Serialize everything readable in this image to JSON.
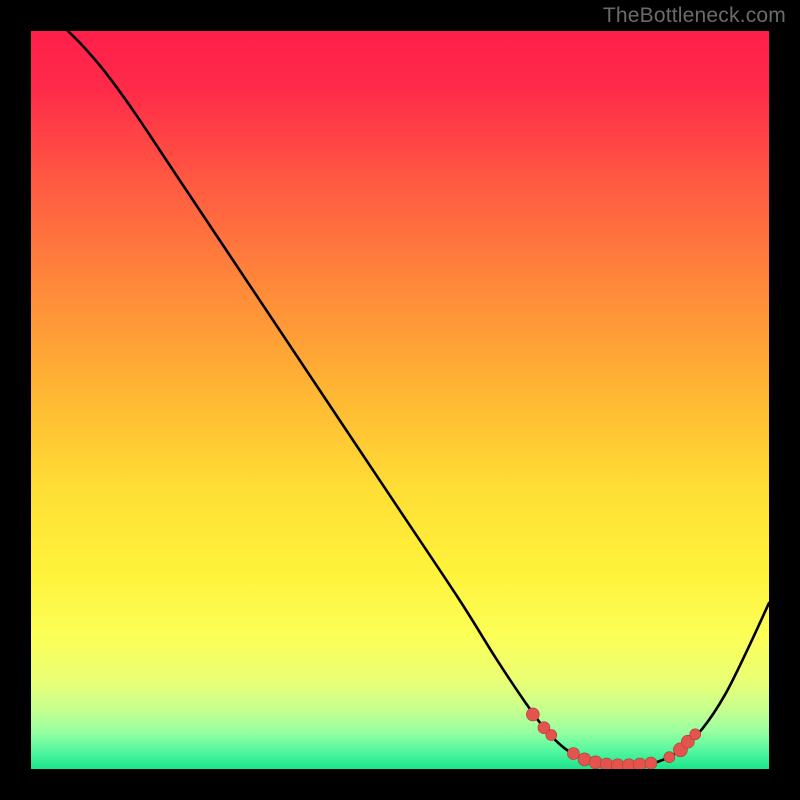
{
  "watermark": "TheBottleneck.com",
  "colors": {
    "curve": "#000000",
    "marker_fill": "#e4544f",
    "marker_stroke": "#b23935"
  },
  "chart_data": {
    "type": "line",
    "title": "",
    "xlabel": "",
    "ylabel": "",
    "xlim": [
      0,
      100
    ],
    "ylim": [
      0,
      100
    ],
    "curve": [
      {
        "x": 5.0,
        "y": 100.0
      },
      {
        "x": 7.0,
        "y": 98.0
      },
      {
        "x": 10.0,
        "y": 94.5
      },
      {
        "x": 14.0,
        "y": 89.0
      },
      {
        "x": 20.0,
        "y": 80.0
      },
      {
        "x": 30.0,
        "y": 65.0
      },
      {
        "x": 40.0,
        "y": 50.0
      },
      {
        "x": 50.0,
        "y": 35.0
      },
      {
        "x": 58.0,
        "y": 23.0
      },
      {
        "x": 63.0,
        "y": 15.0
      },
      {
        "x": 67.0,
        "y": 9.0
      },
      {
        "x": 70.0,
        "y": 5.0
      },
      {
        "x": 73.0,
        "y": 2.3
      },
      {
        "x": 76.0,
        "y": 1.0
      },
      {
        "x": 79.0,
        "y": 0.5
      },
      {
        "x": 82.0,
        "y": 0.5
      },
      {
        "x": 85.0,
        "y": 1.0
      },
      {
        "x": 88.0,
        "y": 2.6
      },
      {
        "x": 91.0,
        "y": 5.5
      },
      {
        "x": 94.0,
        "y": 10.0
      },
      {
        "x": 97.0,
        "y": 16.0
      },
      {
        "x": 100.0,
        "y": 22.5
      }
    ],
    "markers": [
      {
        "x": 68.0,
        "y": 7.4,
        "r": 6.5
      },
      {
        "x": 69.5,
        "y": 5.6,
        "r": 6.0
      },
      {
        "x": 70.5,
        "y": 4.6,
        "r": 5.5
      },
      {
        "x": 73.5,
        "y": 2.1,
        "r": 6.0
      },
      {
        "x": 75.0,
        "y": 1.3,
        "r": 6.5
      },
      {
        "x": 76.5,
        "y": 0.9,
        "r": 6.5
      },
      {
        "x": 78.0,
        "y": 0.6,
        "r": 6.5
      },
      {
        "x": 79.5,
        "y": 0.5,
        "r": 6.5
      },
      {
        "x": 81.0,
        "y": 0.5,
        "r": 6.5
      },
      {
        "x": 82.5,
        "y": 0.6,
        "r": 6.5
      },
      {
        "x": 84.0,
        "y": 0.8,
        "r": 6.0
      },
      {
        "x": 86.5,
        "y": 1.6,
        "r": 5.5
      },
      {
        "x": 88.0,
        "y": 2.6,
        "r": 7.0
      },
      {
        "x": 89.0,
        "y": 3.7,
        "r": 6.5
      },
      {
        "x": 90.0,
        "y": 4.7,
        "r": 5.5
      }
    ]
  }
}
